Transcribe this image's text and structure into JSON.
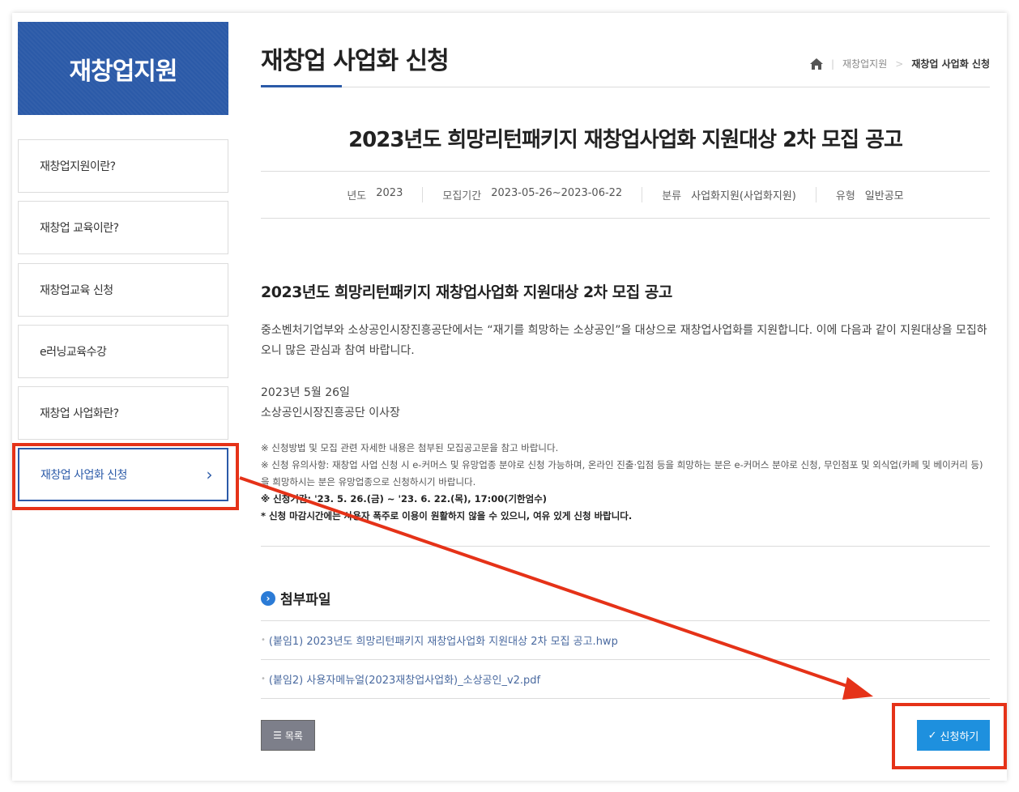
{
  "sidebar": {
    "title": "재창업지원",
    "items": [
      {
        "label": "재창업지원이란?"
      },
      {
        "label": "재창업 교육이란?"
      },
      {
        "label": "재창업교육 신청"
      },
      {
        "label": "e러닝교육수강"
      },
      {
        "label": "재창업 사업화란?"
      },
      {
        "label": "재창업 사업화 신청"
      }
    ]
  },
  "header": {
    "title": "재창업 사업화 신청",
    "breadcrumb": [
      "재창업지원",
      "재창업 사업화 신청"
    ]
  },
  "notice": {
    "title": "2023년도 희망리턴패키지 재창업사업화 지원대상 2차 모집 공고",
    "meta": [
      {
        "label": "년도",
        "value": "2023"
      },
      {
        "label": "모집기간",
        "value": "2023-05-26~2023-06-22"
      },
      {
        "label": "분류",
        "value": "사업화지원(사업화지원)"
      },
      {
        "label": "유형",
        "value": "일반공모"
      }
    ],
    "body_title": "2023년도 희망리턴패키지 재창업사업화 지원대상 2차 모집 공고",
    "body_paragraph": "중소벤처기업부와 소상공인시장진흥공단에서는 “재기를 희망하는 소상공인”을 대상으로 재창업사업화를 지원합니다. 이에 다음과 같이 지원대상을 모집하오니 많은 관심과 참여 바랍니다.",
    "date": "2023년 5월 26일",
    "issuer": "소상공인시장진흥공단 이사장",
    "notes": [
      "※ 신청방법 및 모집 관련 자세한 내용은 첨부된 모집공고문을 참고 바랍니다.",
      "※ 신청 유의사항: 재창업 사업 신청 시 e-커머스 및 유망업종 분야로 신청 가능하며, 온라인 진출·입점 등을 희망하는 분은 e-커머스 분야로 신청, 무인점포 및 외식업(카페 및 베이커리 등)을 희망하시는 분은 유망업종으로 신청하시기 바랍니다.",
      "※  신청기간: '23. 5. 26.(금) ~ '23. 6. 22.(목), 17:00(기한엄수)",
      "* 신청 마감시간에는 사용자 폭주로 이용이 원활하지 않을 수 있으니, 여유 있게 신청 바랍니다."
    ]
  },
  "attachments": {
    "heading": "첨부파일",
    "files": [
      "(붙임1) 2023년도 희망리턴패키지 재창업사업화 지원대상 2차 모집 공고.hwp",
      "(붙임2) 사용자메뉴얼(2023재창업사업화)_소상공인_v2.pdf"
    ]
  },
  "buttons": {
    "list": "목록",
    "apply": "신청하기"
  },
  "colors": {
    "brand": "#2b5aa8",
    "apply": "#1e90de",
    "highlight": "#e53218"
  }
}
